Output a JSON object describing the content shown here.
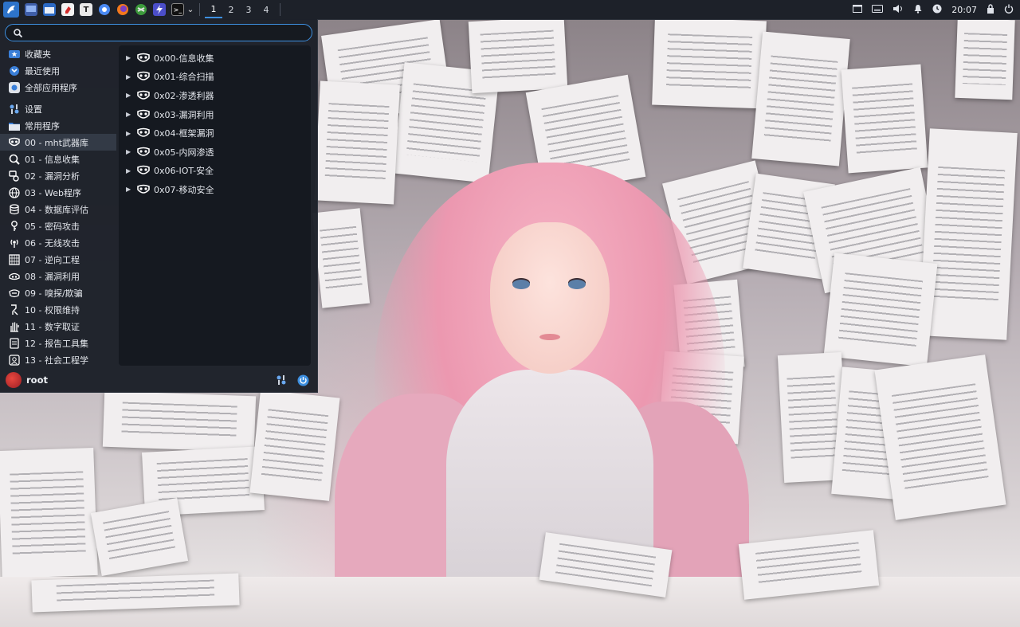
{
  "panel": {
    "workspaces": [
      "1",
      "2",
      "3",
      "4"
    ],
    "active_workspace": "1",
    "clock": "20:07",
    "pinned_apps": [
      "show-desktop-icon",
      "file-manager-icon",
      "text-editor-icon",
      "typora-icon",
      "chromium-icon",
      "firefox-icon",
      "burpsuite-icon",
      "flameshot-icon",
      "terminal-icon"
    ],
    "tray_icons": [
      "window-icon",
      "keyboard-icon",
      "volume-icon",
      "notification-bell-icon",
      "update-icon",
      "lock-icon",
      "power-icon"
    ]
  },
  "menu": {
    "search": {
      "value": "",
      "placeholder": ""
    },
    "categories": [
      {
        "label": "收藏夹",
        "icon": "star-icon"
      },
      {
        "label": "最近使用",
        "icon": "recent-icon"
      },
      {
        "label": "全部应用程序",
        "icon": "all-apps-icon"
      },
      {
        "label": "设置",
        "icon": "settings-icon"
      },
      {
        "label": "常用程序",
        "icon": "folder-icon"
      },
      {
        "label": "00 - mht武器库",
        "icon": "mask-icon",
        "selected": true
      },
      {
        "label": "01 - 信息收集",
        "icon": "magnifier-icon"
      },
      {
        "label": "02 - 漏洞分析",
        "icon": "analysis-icon"
      },
      {
        "label": "03 - Web程序",
        "icon": "globe-icon"
      },
      {
        "label": "04 - 数据库评估",
        "icon": "database-icon"
      },
      {
        "label": "05 - 密码攻击",
        "icon": "key-icon"
      },
      {
        "label": "06 - 无线攻击",
        "icon": "wireless-icon"
      },
      {
        "label": "07 - 逆向工程",
        "icon": "chip-icon"
      },
      {
        "label": "08 - 漏洞利用",
        "icon": "exploit-icon"
      },
      {
        "label": "09 - 嗅探/欺骗",
        "icon": "sniff-icon"
      },
      {
        "label": "10 - 权限维持",
        "icon": "persistence-icon"
      },
      {
        "label": "11 - 数字取证",
        "icon": "hand-icon"
      },
      {
        "label": "12 - 报告工具集",
        "icon": "report-icon"
      },
      {
        "label": "13 - 社会工程学",
        "icon": "social-icon"
      }
    ],
    "submenus": [
      {
        "label": "0x00-信息收集"
      },
      {
        "label": "0x01-综合扫描"
      },
      {
        "label": "0x02-渗透利器"
      },
      {
        "label": "0x03-漏洞利用"
      },
      {
        "label": "0x04-框架漏洞"
      },
      {
        "label": "0x05-内网渗透"
      },
      {
        "label": "0x06-IOT-安全"
      },
      {
        "label": "0x07-移动安全"
      }
    ],
    "user": "root"
  },
  "colors": {
    "panel_bg": "#1d2129",
    "menu_bg": "#1c2028",
    "accent": "#3d8fe0",
    "selected_bg": "#333a46"
  }
}
